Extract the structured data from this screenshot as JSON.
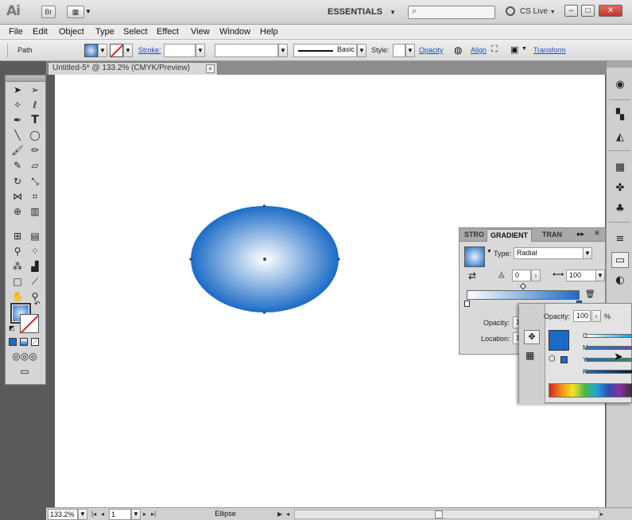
{
  "app": {
    "logo": "Ai",
    "workspace": "ESSENTIALS",
    "cs_live": "CS Live"
  },
  "menu": [
    "File",
    "Edit",
    "Object",
    "Type",
    "Select",
    "Effect",
    "View",
    "Window",
    "Help"
  ],
  "control_bar": {
    "selection": "Path",
    "stroke_label": "Stroke:",
    "brush_label": "Basic",
    "style_label": "Style:",
    "opacity_link": "Opacity",
    "align_link": "Align",
    "transform_link": "Transform"
  },
  "document_tab": {
    "title": "Untitled-5* @ 133.2% (CMYK/Preview)",
    "close": "×"
  },
  "gradient_panel": {
    "tabs": [
      "STRO",
      "GRADIENT",
      "TRAN"
    ],
    "active_tab": "GRADIENT",
    "type_label": "Type:",
    "type_value": "Radial",
    "angle_value": "0",
    "aspect_value": "100",
    "opacity_label": "Opacity:",
    "location_label": "Location:",
    "opacity_value": "1",
    "location_value": "1"
  },
  "color_panel": {
    "opacity_label": "Opacity:",
    "opacity_value": "100",
    "percent": "%",
    "channels": [
      "C",
      "M",
      "Y",
      "K"
    ],
    "fill_color": "#1b6bc6"
  },
  "status_bar": {
    "zoom": "133.2%",
    "page": "1",
    "tool": "Ellipse"
  },
  "colors": {
    "gradient_start": "#ffffff",
    "gradient_end": "#1b6bc6"
  }
}
